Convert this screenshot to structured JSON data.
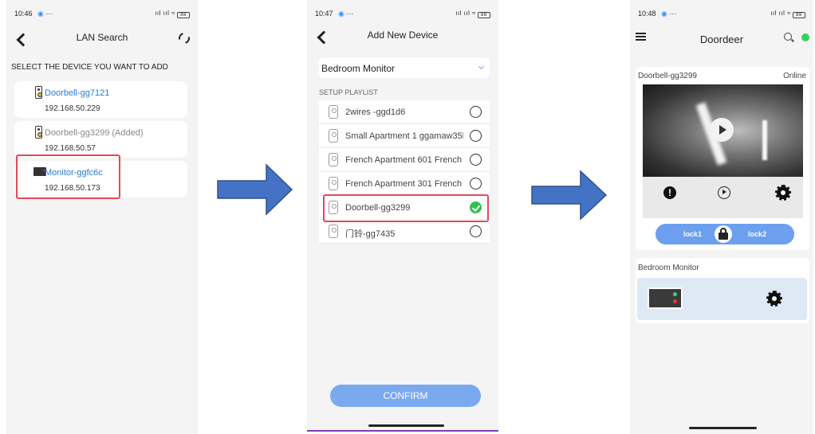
{
  "screen1": {
    "time": "10:46",
    "title": "LAN Search",
    "section_label": "SELECT THE DEVICE YOU WANT TO ADD",
    "devices": [
      {
        "name": "Doorbell-gg7121",
        "ip": "192.168.50.229"
      },
      {
        "name": "Doorbell-gg3299 (Added)",
        "ip": "192.168.50.57"
      },
      {
        "name": "Monitor-ggfc6c",
        "ip": "192.168.50.173"
      }
    ]
  },
  "screen2": {
    "time": "10:47",
    "title": "Add New Device",
    "selected_device": "Bedroom Monitor",
    "playlist_label": "SETUP PLAYLIST",
    "playlist": [
      {
        "name": "2wires -ggd1d6",
        "checked": false
      },
      {
        "name": "Small Apartment 1 ggamaw35b",
        "checked": false
      },
      {
        "name": "French Apartment 601 French A",
        "checked": false
      },
      {
        "name": "French Apartment 301 French A",
        "checked": false
      },
      {
        "name": "Doorbell-gg3299",
        "checked": true
      },
      {
        "name": "门铃-gg7435",
        "checked": false
      }
    ],
    "confirm_label": "CONFIRM"
  },
  "screen3": {
    "time": "10:48",
    "title": "Doordeer",
    "camera_name": "Doorbell-gg3299",
    "camera_status": "Online",
    "alert_glyph": "!",
    "lock1_label": "lock1",
    "lock2_label": "lock2",
    "monitor_name": "Bedroom Monitor"
  },
  "colors": {
    "link_blue": "#2b7cd3",
    "highlight_red": "#e24a5a",
    "button_blue": "#7aa9f0",
    "check_green": "#34c04f",
    "arrow_fill": "#4472c4"
  }
}
